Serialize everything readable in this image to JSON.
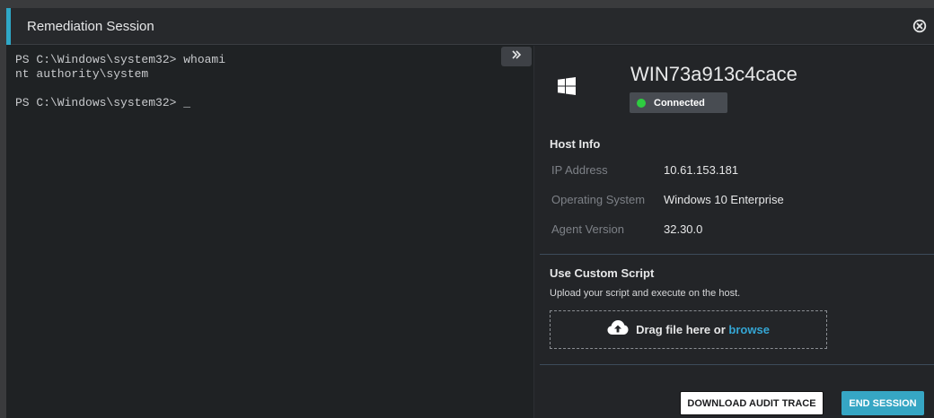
{
  "window": {
    "title": "Remediation Session"
  },
  "terminal": {
    "lines": [
      "PS C:\\Windows\\system32> whoami",
      "nt authority\\system",
      "",
      "PS C:\\Windows\\system32> _"
    ]
  },
  "host": {
    "name": "WIN73a913c4cace",
    "status": "Connected",
    "status_color": "#2ecc40",
    "os_icon": "windows-logo-icon"
  },
  "host_info": {
    "title": "Host Info",
    "rows": [
      {
        "key": "IP Address",
        "value": "10.61.153.181"
      },
      {
        "key": "Operating System",
        "value": "Windows 10 Enterprise"
      },
      {
        "key": "Agent Version",
        "value": "32.30.0"
      }
    ]
  },
  "custom_script": {
    "title": "Use Custom Script",
    "helper": "Upload your script and execute on the host.",
    "dropzone_text": "Drag file here or",
    "browse_label": "browse"
  },
  "actions": {
    "download_label": "DOWNLOAD AUDIT TRACE",
    "end_label": "END SESSION"
  },
  "colors": {
    "accent": "#2fa7c6",
    "link": "#34a6d4",
    "primary_button": "#36a6c4"
  }
}
